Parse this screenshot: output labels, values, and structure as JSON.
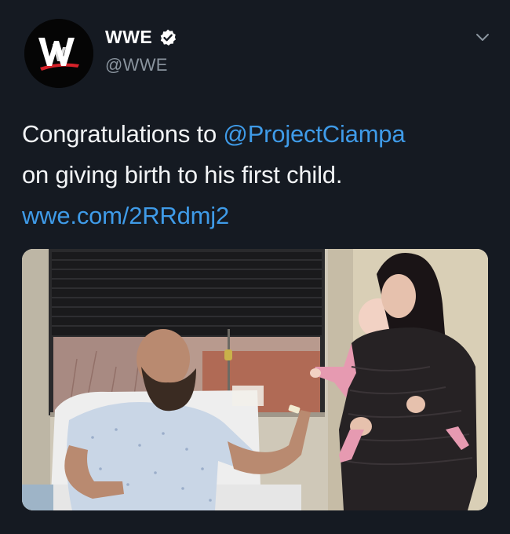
{
  "tweet": {
    "display_name": "WWE",
    "handle": "@WWE",
    "text_prefix": "Congratulations to ",
    "mention": "@ProjectCiampa",
    "text_line2": "on giving birth to his first child.",
    "link": "wwe.com/2RRdmj2"
  },
  "icons": {
    "avatar": "wwe-logo",
    "verified": "verified-badge-icon",
    "menu": "chevron-down-icon"
  },
  "colors": {
    "background": "#151a22",
    "link": "#3f9be8",
    "handle": "#8a949e",
    "logo_accent": "#d6222a"
  }
}
